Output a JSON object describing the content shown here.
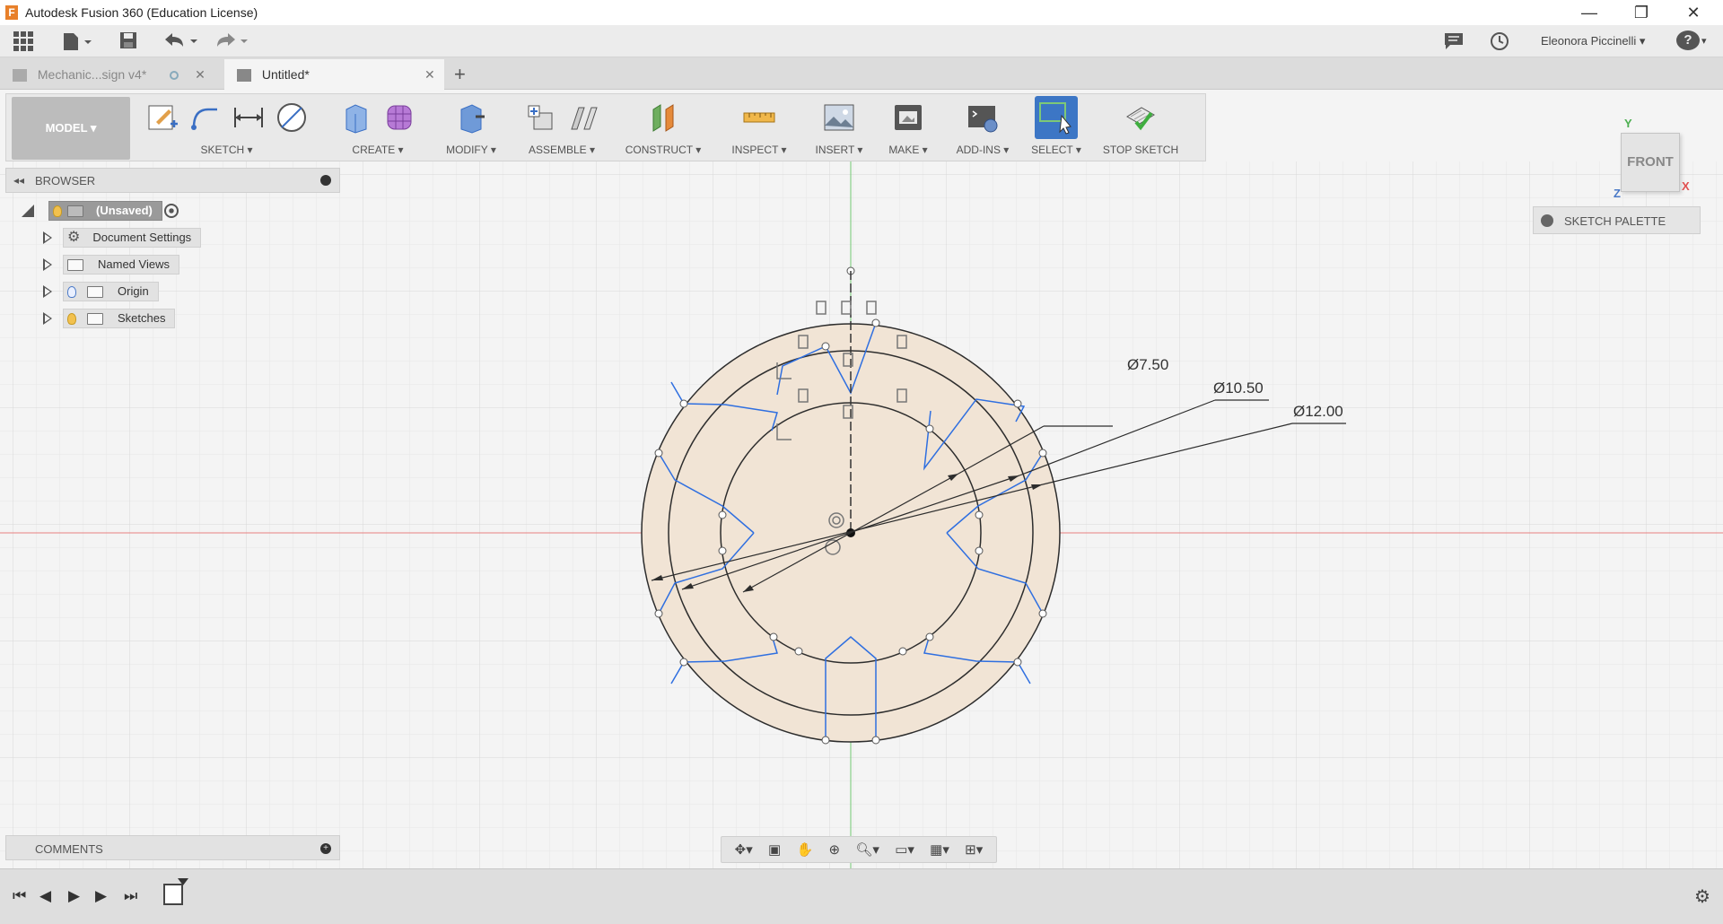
{
  "window": {
    "title": "Autodesk Fusion 360 (Education License)",
    "app_icon": "F",
    "controls": [
      "minimize",
      "restore",
      "close"
    ]
  },
  "appbar": {
    "user_name": "Eleonora Piccinelli ▾",
    "help": "?"
  },
  "tabs": [
    {
      "label": "Mechanic...sign v4*",
      "active": false
    },
    {
      "label": "Untitled*",
      "active": true
    }
  ],
  "toolbar": {
    "workspace": "MODEL ▾",
    "groups": [
      {
        "label": "SKETCH ▾"
      },
      {
        "label": "CREATE ▾"
      },
      {
        "label": "MODIFY ▾"
      },
      {
        "label": "ASSEMBLE ▾"
      },
      {
        "label": "CONSTRUCT ▾"
      },
      {
        "label": "INSPECT ▾"
      },
      {
        "label": "INSERT ▾"
      },
      {
        "label": "MAKE ▾"
      },
      {
        "label": "ADD-INS ▾"
      },
      {
        "label": "SELECT ▾"
      },
      {
        "label": "STOP SKETCH"
      }
    ]
  },
  "browser": {
    "header": "BROWSER",
    "root": "(Unsaved)",
    "items": [
      {
        "label": "Document Settings"
      },
      {
        "label": "Named Views"
      },
      {
        "label": "Origin"
      },
      {
        "label": "Sketches"
      }
    ]
  },
  "comments": {
    "header": "COMMENTS"
  },
  "sketch_palette": {
    "header": "SKETCH PALETTE"
  },
  "viewcube": {
    "face": "FRONT",
    "axis_y": "Y",
    "axis_x": "X",
    "axis_z": "Z"
  },
  "dimensions": [
    {
      "label": "Ø7.50"
    },
    {
      "label": "Ø10.50"
    },
    {
      "label": "Ø12.00"
    }
  ],
  "colors": {
    "sketch_fill": "#f1e4d5",
    "sketch_line": "#2d2d2d",
    "construction_blue": "#2f6fe0",
    "axis_red": "#e88080",
    "axis_green": "#72c872",
    "select_active": "#3c76c5"
  }
}
